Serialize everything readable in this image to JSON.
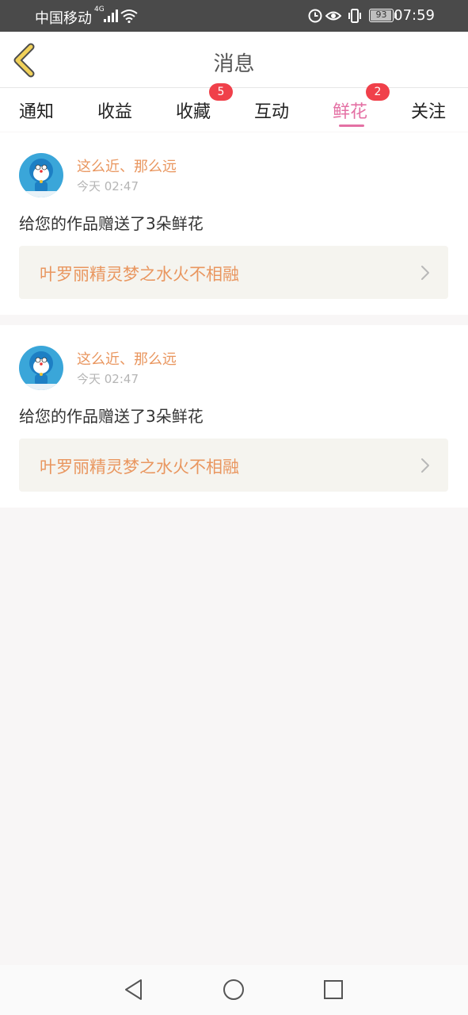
{
  "status_bar": {
    "carrier": "中国移动",
    "network": "4G",
    "battery": "93",
    "time": "07:59",
    "icons": [
      "signal-icon",
      "wifi-icon",
      "alarm-icon",
      "eye-icon",
      "vibrate-icon",
      "battery-icon"
    ]
  },
  "header": {
    "title": "消息",
    "back_icon": "chevron-left-icon",
    "accent_color": "#f1d15a"
  },
  "tabs": {
    "items": [
      {
        "label": "通知"
      },
      {
        "label": "收益"
      },
      {
        "label": "收藏",
        "badge": "5"
      },
      {
        "label": "互动"
      },
      {
        "label": "鲜花",
        "badge": "2",
        "active": true
      },
      {
        "label": "关注"
      }
    ],
    "active_color": "#e470a4",
    "badge_color": "#f0404a"
  },
  "messages": [
    {
      "username": "这么近、那么远",
      "time": "今天 02:47",
      "text": "给您的作品赠送了3朵鲜花",
      "work_title": "叶罗丽精灵梦之水火不相融"
    },
    {
      "username": "这么近、那么远",
      "time": "今天 02:47",
      "text": "给您的作品赠送了3朵鲜花",
      "work_title": "叶罗丽精灵梦之水火不相融"
    }
  ],
  "system_nav": {
    "icons": [
      "back-triangle-icon",
      "home-circle-icon",
      "recents-square-icon"
    ]
  }
}
